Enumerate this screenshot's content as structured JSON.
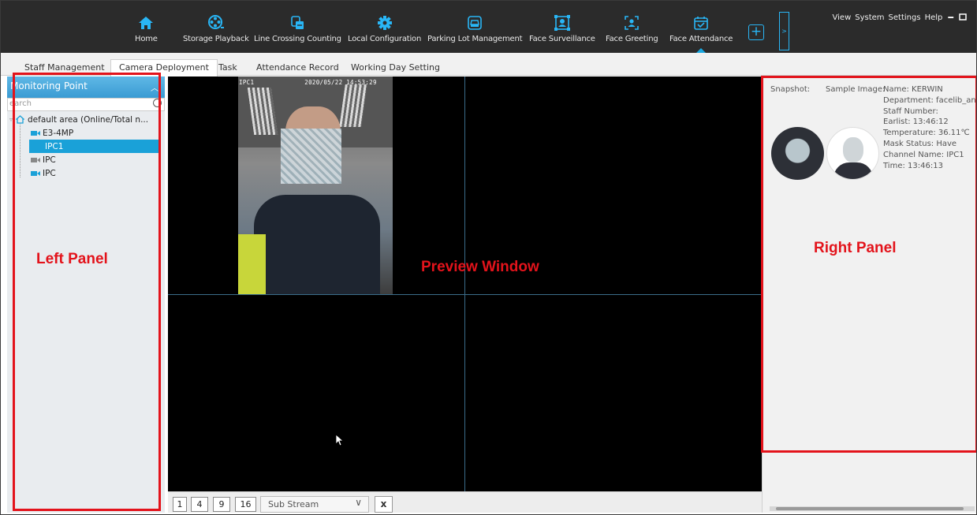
{
  "topbar": {
    "nav": [
      {
        "label": "Home",
        "icon": "home-icon"
      },
      {
        "label": "Storage Playback",
        "icon": "film-reel-icon"
      },
      {
        "label": "Line Crossing Counting",
        "icon": "line-crossing-icon"
      },
      {
        "label": "Local Configuration",
        "icon": "gear-icon"
      },
      {
        "label": "Parking Lot Management",
        "icon": "car-icon"
      },
      {
        "label": "Face Surveillance",
        "icon": "face-frame-icon"
      },
      {
        "label": "Face Greeting",
        "icon": "face-scan-icon"
      },
      {
        "label": "Face Attendance",
        "icon": "calendar-check-icon"
      }
    ],
    "active_index": 7,
    "add_label": "+",
    "more_label": ">",
    "system_menu": [
      "View",
      "System",
      "Settings",
      "Help"
    ],
    "accent_color": "#1aa7e0"
  },
  "tabs": [
    "Staff Management",
    "Camera Deployment",
    "Task",
    "Attendance Record",
    "Working Day Setting"
  ],
  "active_tab": "Camera Deployment",
  "left": {
    "header": "Monitoring Point",
    "search_placeholder": "earch",
    "tree": {
      "root": "default area (Online/Total n...",
      "children": [
        "E3-4MP",
        "IPC1",
        "IPC",
        "IPC"
      ],
      "selected": "IPC1"
    }
  },
  "preview": {
    "osd_channel": "IPC1",
    "osd_timestamp": "2020/05/22 14:53:29",
    "layout_buttons": [
      "1",
      "4",
      "9",
      "16"
    ],
    "stream": "Sub Stream"
  },
  "right": {
    "snapshot_label": "Snapshot:",
    "sample_label": "Sample Image:",
    "info": [
      "Name: KERWIN",
      "Department: facelib_anf",
      "Staff Number:",
      "Earlist: 13:46:12",
      "Temperature: 36.11℃",
      "Mask Status: Have",
      "Channel Name: IPC1",
      "Time: 13:46:13"
    ]
  },
  "annotations": {
    "left": "Left Panel",
    "preview": "Preview Window",
    "right": "Right Panel",
    "color": "#e3131b"
  }
}
